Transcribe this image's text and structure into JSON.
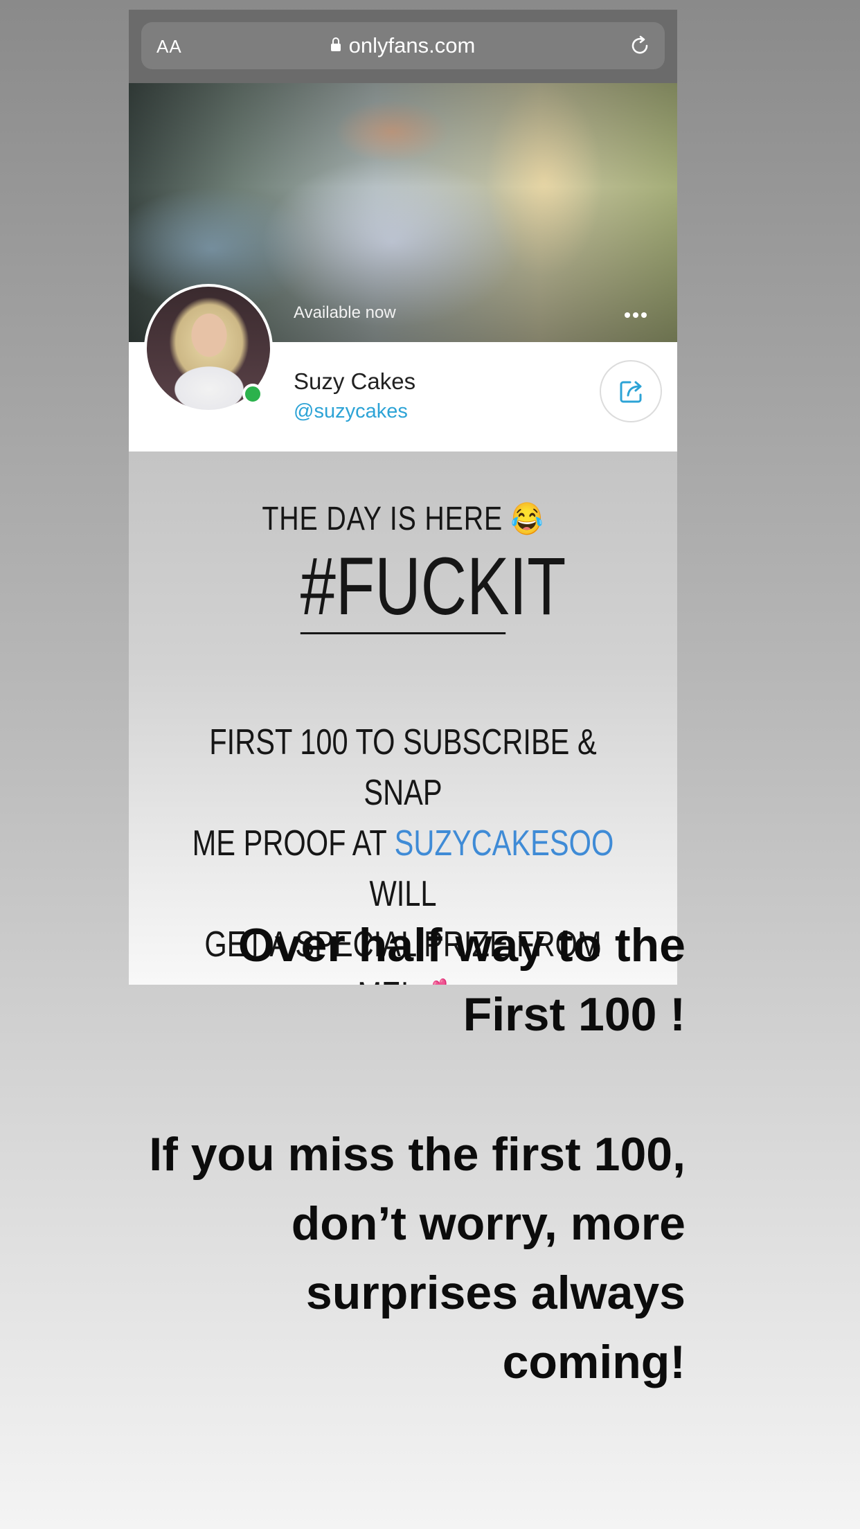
{
  "browser": {
    "text_size_label": "AA",
    "url": "onlyfans.com",
    "lock_icon": "lock-icon",
    "reload_icon": "reload-icon"
  },
  "profile": {
    "status": "Available now",
    "name": "Suzy Cakes",
    "handle": "@suzycakes",
    "online_color": "#2bb24c",
    "handle_color": "#2ca3d6"
  },
  "story": {
    "line1": "THE DAY IS HERE",
    "line1_emoji": "😂",
    "hashtag": "#FUCKIT",
    "promo_part1": "FIRST 100 TO SUBSCRIBE & SNAP",
    "promo_part2a": "ME PROOF AT",
    "promo_highlight": "SUZYCAKESOO",
    "promo_part2b": "WILL",
    "promo_part3": "GET A SPECIAL PRIZE FROM ME!",
    "promo_emoji": "💕",
    "highlight_color": "#3f8bd6"
  },
  "caption": {
    "line1": "Over half way to the",
    "line2": "First 100 !",
    "line3": "If you miss the first 100,",
    "line4": "don’t worry, more",
    "line5": "surprises always",
    "line6": "coming!"
  }
}
